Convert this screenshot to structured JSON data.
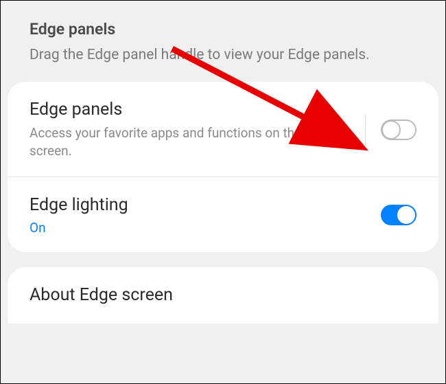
{
  "header": {
    "title": "Edge panels",
    "subtitle": "Drag the Edge panel handle to view your Edge panels."
  },
  "settings": {
    "edge_panels": {
      "title": "Edge panels",
      "subtitle": "Access your favorite apps and functions on the Edge screen.",
      "enabled": false
    },
    "edge_lighting": {
      "title": "Edge lighting",
      "status": "On",
      "enabled": true
    }
  },
  "about": {
    "title": "About Edge screen"
  }
}
